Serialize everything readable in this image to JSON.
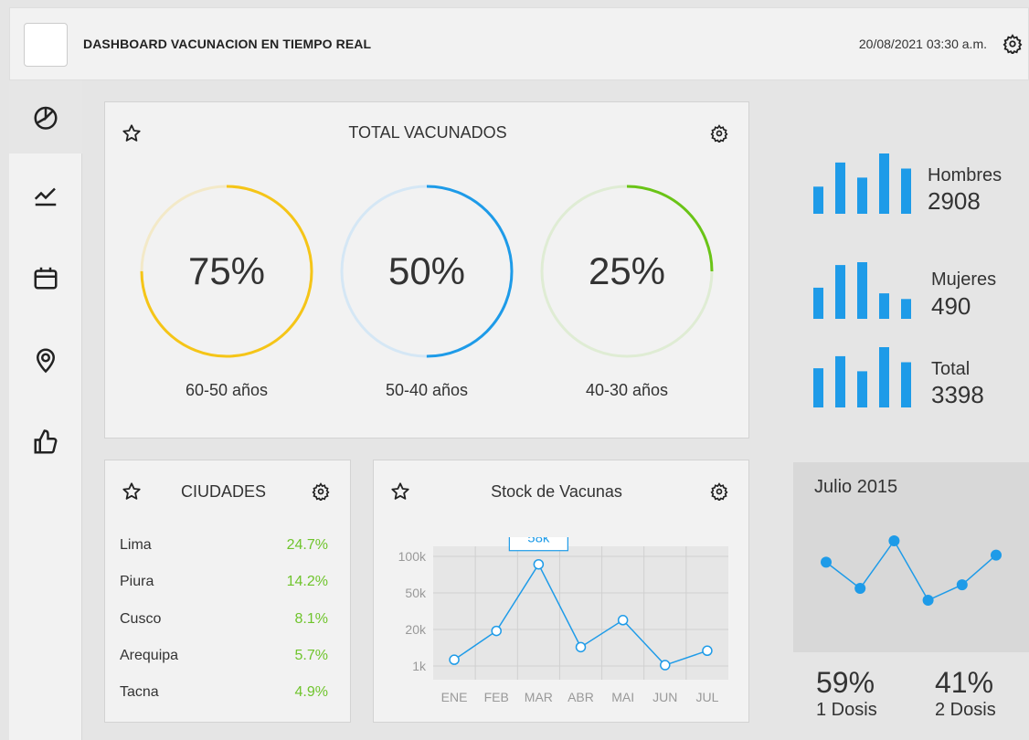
{
  "header": {
    "title": "DASHBOARD VACUNACION EN TIEMPO REAL",
    "datetime": "20/08/2021 03:30 a.m."
  },
  "sidebar": {
    "items": [
      {
        "icon": "pie-chart-icon",
        "active": true
      },
      {
        "icon": "line-chart-icon",
        "active": false
      },
      {
        "icon": "calendar-icon",
        "active": false
      },
      {
        "icon": "location-pin-icon",
        "active": false
      },
      {
        "icon": "thumbs-up-icon",
        "active": false
      }
    ]
  },
  "total": {
    "title": "TOTAL VACUNADOS",
    "rings": [
      {
        "pct": "75%",
        "fraction": 0.75,
        "label": "60-50 años",
        "color": "#f5c518",
        "track": "#f3e9c8"
      },
      {
        "pct": "50%",
        "fraction": 0.5,
        "label": "50-40 años",
        "color": "#1e9be8",
        "track": "#d5e7f5"
      },
      {
        "pct": "25%",
        "fraction": 0.25,
        "label": "40-30 años",
        "color": "#6ac417",
        "track": "#dfecd4"
      }
    ]
  },
  "stats": [
    {
      "name": "Hombres",
      "value": "2908",
      "bars": [
        0.45,
        0.85,
        0.6,
        1.0,
        0.75
      ]
    },
    {
      "name": "Mujeres",
      "value": "490",
      "bars": [
        0.55,
        0.95,
        1.0,
        0.45,
        0.35
      ]
    },
    {
      "name": "Total",
      "value": "3398",
      "bars": [
        0.65,
        0.85,
        0.6,
        1.0,
        0.75
      ]
    }
  ],
  "cities": {
    "title": "CIUDADES",
    "rows": [
      {
        "name": "Lima",
        "value": "24.7%"
      },
      {
        "name": "Piura",
        "value": "14.2%"
      },
      {
        "name": "Cusco",
        "value": "8.1%"
      },
      {
        "name": "Arequipa",
        "value": "5.7%"
      },
      {
        "name": "Tacna",
        "value": "4.9%"
      }
    ]
  },
  "stock": {
    "title": "Stock de Vacunas",
    "tooltip": "58k",
    "accent": "#1e9be8"
  },
  "chart_data": [
    {
      "type": "line",
      "title": "Stock de Vacunas",
      "categories": [
        "ENE",
        "FEB",
        "MAR",
        "ABR",
        "MAI",
        "JUN",
        "JUL"
      ],
      "y_ticks": [
        "100k",
        "50k",
        "20k",
        "1k"
      ],
      "values": [
        5,
        21,
        58,
        12,
        27,
        2,
        10
      ],
      "annotation": {
        "category": "MAR",
        "label": "58k"
      }
    },
    {
      "type": "line",
      "title": "Julio 2015",
      "values": [
        62,
        40,
        80,
        30,
        43,
        68
      ],
      "ylim": [
        0,
        100
      ]
    }
  ],
  "july": {
    "title": "Julio 2015"
  },
  "doses": [
    {
      "pct": "59%",
      "label": "1 Dosis"
    },
    {
      "pct": "41%",
      "label": "2 Dosis"
    }
  ]
}
